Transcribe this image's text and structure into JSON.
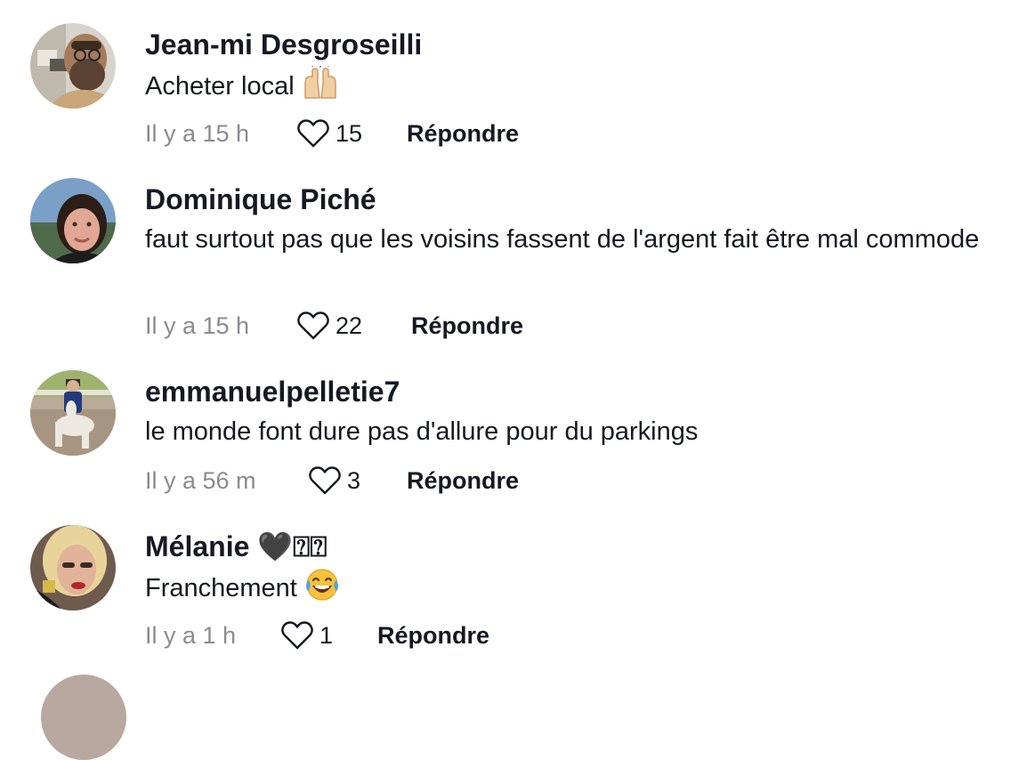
{
  "comments": [
    {
      "username": "Jean-mi Desgroseilli",
      "text": "Acheter local",
      "emoji": "raising-hands",
      "time": "Il y a 15 h",
      "likes": "15",
      "reply": "Répondre"
    },
    {
      "username": "Dominique Piché",
      "text": "faut surtout pas que les voisins fassent de l'argent fait être mal commode",
      "time": "Il y a 15 h",
      "likes": "22",
      "reply": "Répondre"
    },
    {
      "username": "emmanuelpelletie7",
      "text": "le monde font dure pas d'allure pour du parkings",
      "time": "Il y a 56 m",
      "likes": "3",
      "reply": "Répondre"
    },
    {
      "username": "Mélanie 🖤⍰⍰",
      "text": "Franchement",
      "emoji": "tears-of-joy",
      "time": "Il y a 1 h",
      "likes": "1",
      "reply": "Répondre"
    }
  ],
  "colors": {
    "text": "#161823",
    "muted": "#8a8b91",
    "background": "#ffffff"
  },
  "icons": {
    "like": "heart-outline-icon"
  }
}
